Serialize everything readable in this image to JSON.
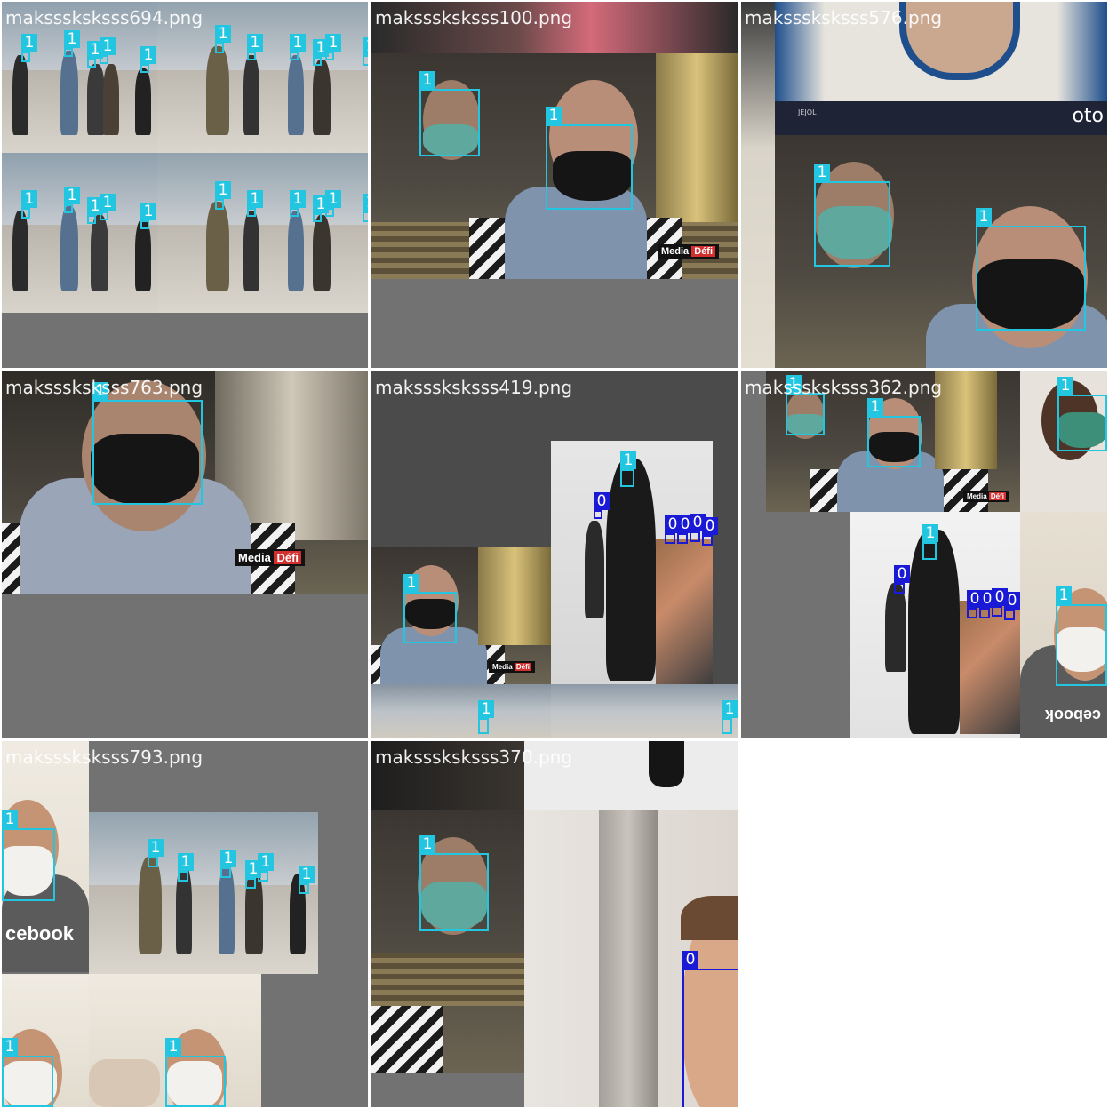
{
  "tiles": [
    {
      "name": "maksssksksss694.png"
    },
    {
      "name": "maksssksksss100.png"
    },
    {
      "name": "maksssksksss576.png"
    },
    {
      "name": "maksssksksss763.png"
    },
    {
      "name": "maksssksksss419.png"
    },
    {
      "name": "maksssksksss362.png"
    },
    {
      "name": "maksssksksss793.png"
    },
    {
      "name": "maksssksksss370.png"
    }
  ],
  "labels": {
    "mask": "1",
    "no_mask": "0"
  },
  "overlay_text": {
    "media": "Media",
    "media_brand": "Défi",
    "facebook": "cebook",
    "oto": "oto",
    "small_print": "JEJOL"
  },
  "colors": {
    "mask_class": "#22c6e0",
    "no_mask_class": "#1a1ad6",
    "padding": "#727272"
  }
}
